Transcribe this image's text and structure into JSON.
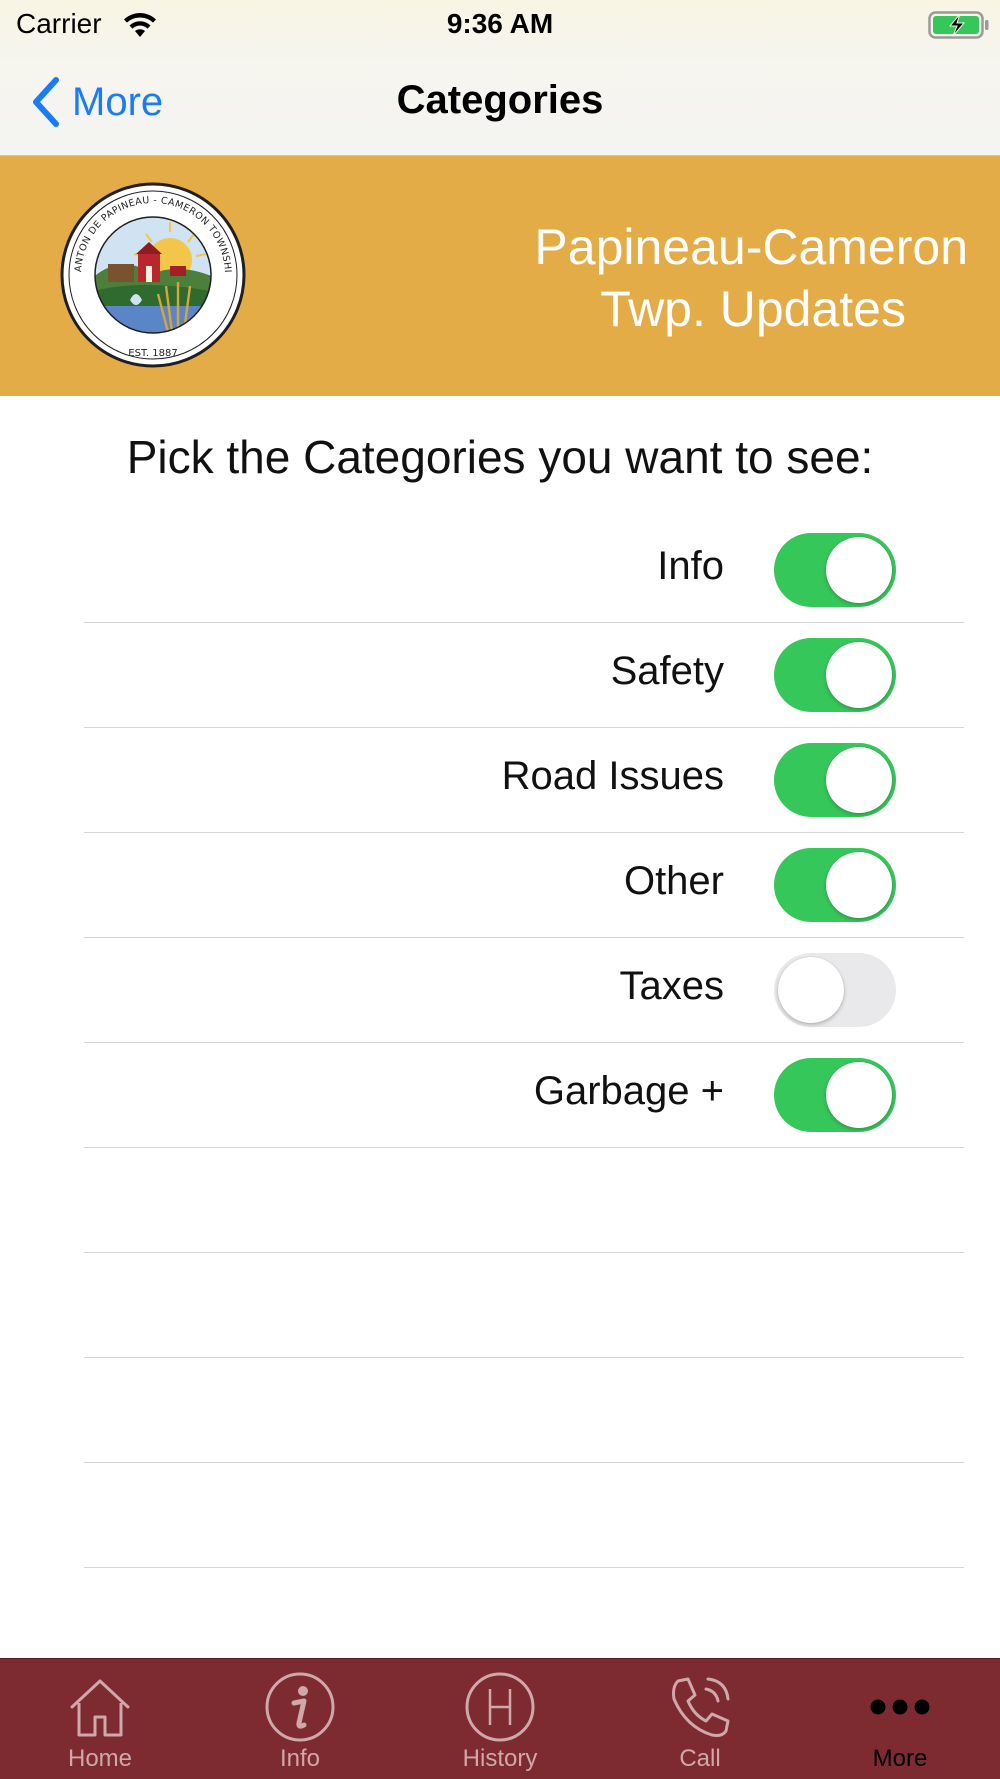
{
  "status_bar": {
    "carrier": "Carrier",
    "time": "9:36 AM",
    "wifi_icon": "wifi-icon",
    "battery_icon": "battery-charging-icon"
  },
  "nav": {
    "back_label": "More",
    "title": "Categories"
  },
  "banner": {
    "title_line1": "Papineau-Cameron",
    "title_line2": "Twp. Updates",
    "background_color": "#e4ac46",
    "seal": {
      "ring_text": "CANTON DE PAPINEAU - CAMERON TOWNSHIP",
      "established": "EST. 1887"
    }
  },
  "prompt": "Pick the Categories you want to see:",
  "categories": [
    {
      "label": "Info",
      "enabled": true
    },
    {
      "label": "Safety",
      "enabled": true
    },
    {
      "label": "Road Issues",
      "enabled": true
    },
    {
      "label": "Other",
      "enabled": true
    },
    {
      "label": "Taxes",
      "enabled": false
    },
    {
      "label": "Garbage +",
      "enabled": true
    }
  ],
  "toggle_on_color": "#36c75a",
  "toggle_off_color": "#e9e9eb",
  "tab_bar": {
    "background_color": "#7d2a31",
    "tabs": [
      {
        "label": "Home",
        "icon": "home-icon",
        "active": false
      },
      {
        "label": "Info",
        "icon": "info-icon",
        "active": false
      },
      {
        "label": "History",
        "icon": "history-icon",
        "active": false
      },
      {
        "label": "Call",
        "icon": "phone-icon",
        "active": false
      },
      {
        "label": "More",
        "icon": "more-icon",
        "active": true
      }
    ]
  }
}
